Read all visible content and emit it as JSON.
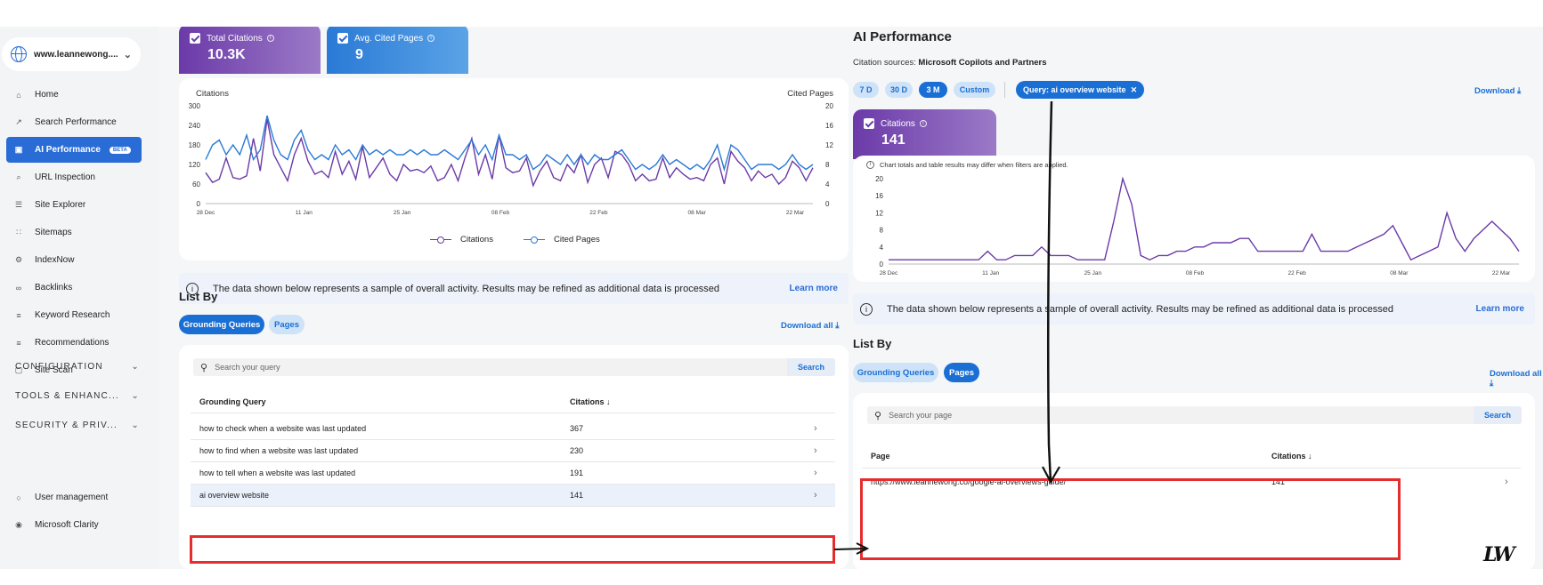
{
  "sidebar": {
    "site": "www.leannewong....",
    "items": [
      {
        "label": "Home",
        "icon": "home-icon"
      },
      {
        "label": "Search Performance",
        "icon": "trend-icon"
      },
      {
        "label": "AI Performance",
        "icon": "ai-icon",
        "badge": "BETA"
      },
      {
        "label": "URL Inspection",
        "icon": "search-icon"
      },
      {
        "label": "Site Explorer",
        "icon": "list-icon"
      },
      {
        "label": "Sitemaps",
        "icon": "sitemap-icon"
      },
      {
        "label": "IndexNow",
        "icon": "gear-icon"
      },
      {
        "label": "Backlinks",
        "icon": "link-icon"
      },
      {
        "label": "Keyword Research",
        "icon": "doc-icon"
      },
      {
        "label": "Recommendations",
        "icon": "doc-icon"
      },
      {
        "label": "Site Scan",
        "icon": "scan-icon"
      }
    ],
    "groups": [
      "CONFIGURATION",
      "TOOLS & ENHANC...",
      "SECURITY & PRIV..."
    ],
    "bottom_items": [
      {
        "label": "User management",
        "icon": "user-icon"
      },
      {
        "label": "Microsoft Clarity",
        "icon": "clarity-icon"
      }
    ]
  },
  "left": {
    "total_citations_label": "Total Citations",
    "total_citations_value": "10.3K",
    "avg_cited_label": "Avg. Cited Pages",
    "avg_cited_value": "9",
    "chart_left_title": "Citations",
    "chart_right_title": "Cited Pages",
    "legend": [
      "Citations",
      "Cited Pages"
    ],
    "banner_text": "The data shown below represents a sample of overall activity. Results may be refined as additional data is processed",
    "learn_more": "Learn more",
    "list_by": "List By",
    "tabs": [
      "Grounding Queries",
      "Pages"
    ],
    "download_all": "Download all",
    "search_placeholder": "Search your query",
    "search_btn": "Search",
    "col1": "Grounding Query",
    "col2": "Citations",
    "rows": [
      {
        "q": "how to check when a website was last updated",
        "c": "367"
      },
      {
        "q": "how to find when a website was last updated",
        "c": "230"
      },
      {
        "q": "how to tell when a website was last updated",
        "c": "191"
      },
      {
        "q": "ai overview website",
        "c": "141"
      }
    ]
  },
  "right": {
    "title": "AI Performance",
    "sources_label": "Citation sources:",
    "sources_value": "Microsoft Copilots and Partners",
    "ranges": [
      "7 D",
      "30 D",
      "3 M",
      "Custom"
    ],
    "active_range": "3 M",
    "query_chip": "Query: ai overview website",
    "download": "Download",
    "citations_label": "Citations",
    "citations_value": "141",
    "note": "Chart totals and table results may differ when filters are applied.",
    "banner_text": "The data shown below represents a sample of overall activity. Results may be refined as additional data is processed",
    "learn_more": "Learn more",
    "list_by": "List By",
    "tabs": [
      "Grounding Queries",
      "Pages"
    ],
    "download_all": "Download all",
    "search_placeholder": "Search your page",
    "search_btn": "Search",
    "col1": "Page",
    "col2": "Citations",
    "rows": [
      {
        "p": "https://www.leannewong.co/google-ai-overviews-guide/",
        "c": "141"
      }
    ]
  },
  "logo_text": "LW",
  "colors": {
    "accent": "#1a6fd4",
    "purple": "#6b3aa8",
    "blue": "#2a7ad6",
    "highlight": "#e52d2d"
  },
  "chart_data": [
    {
      "type": "line",
      "x_ticks": [
        "28 Dec",
        "11 Jan",
        "25 Jan",
        "08 Feb",
        "22 Feb",
        "08 Mar",
        "22 Mar"
      ],
      "ylabel": "Citations",
      "y2label": "Cited Pages",
      "ylim": [
        0,
        300
      ],
      "y_ticks": [
        0,
        60,
        120,
        180,
        240,
        300
      ],
      "y2lim": [
        0,
        20
      ],
      "y2_ticks": [
        0,
        4,
        8,
        12,
        16,
        20
      ],
      "series": [
        {
          "name": "Citations",
          "axis": "left",
          "values": [
            95,
            65,
            75,
            140,
            80,
            75,
            85,
            200,
            100,
            260,
            150,
            110,
            70,
            150,
            200,
            130,
            90,
            100,
            80,
            160,
            90,
            130,
            75,
            175,
            80,
            110,
            140,
            90,
            70,
            120,
            100,
            105,
            95,
            115,
            70,
            80,
            120,
            70,
            140,
            200,
            90,
            150,
            75,
            210,
            110,
            95,
            100,
            140,
            55,
            100,
            130,
            80,
            70,
            120,
            95,
            150,
            65,
            120,
            140,
            80,
            160,
            150,
            120,
            70,
            90,
            70,
            75,
            140,
            80,
            110,
            90,
            75,
            80,
            70,
            120,
            140,
            60,
            160,
            130,
            110,
            70,
            100,
            80,
            90,
            60,
            80,
            130,
            110,
            70,
            110
          ]
        },
        {
          "name": "Cited Pages",
          "axis": "right",
          "values": [
            9,
            12,
            13,
            10,
            12,
            10,
            14,
            9,
            11,
            18,
            13,
            10,
            9,
            13,
            15,
            11,
            9,
            10,
            9,
            12,
            10,
            11,
            9,
            12,
            10,
            11,
            10,
            11,
            10,
            10,
            11,
            10,
            11,
            10,
            10,
            11,
            10,
            9,
            11,
            13,
            10,
            12,
            9,
            14,
            10,
            10,
            9,
            10,
            7,
            8,
            10,
            9,
            8,
            10,
            8,
            10,
            8,
            10,
            9,
            9,
            10,
            11,
            9,
            7,
            8,
            7,
            8,
            10,
            8,
            9,
            8,
            7,
            8,
            7,
            9,
            12,
            7,
            12,
            11,
            9,
            7,
            8,
            8,
            8,
            7,
            8,
            10,
            8,
            7,
            8
          ]
        }
      ]
    },
    {
      "type": "line",
      "x_ticks": [
        "28 Dec",
        "11 Jan",
        "25 Jan",
        "08 Feb",
        "22 Feb",
        "08 Mar",
        "22 Mar"
      ],
      "ylim": [
        0,
        20
      ],
      "y_ticks": [
        0,
        4,
        8,
        12,
        16,
        20
      ],
      "series": [
        {
          "name": "Citations",
          "values": [
            1,
            1,
            1,
            1,
            1,
            1,
            1,
            1,
            1,
            1,
            1,
            3,
            1,
            1,
            2,
            2,
            2,
            4,
            2,
            2,
            2,
            1,
            1,
            1,
            1,
            10,
            20,
            14,
            2,
            1,
            2,
            2,
            3,
            3,
            4,
            4,
            5,
            5,
            5,
            6,
            6,
            3,
            3,
            3,
            3,
            3,
            3,
            7,
            3,
            3,
            3,
            3,
            4,
            5,
            6,
            7,
            9,
            5,
            1,
            2,
            3,
            4,
            12,
            6,
            3,
            6,
            8,
            10,
            8,
            6,
            3
          ]
        }
      ]
    }
  ]
}
